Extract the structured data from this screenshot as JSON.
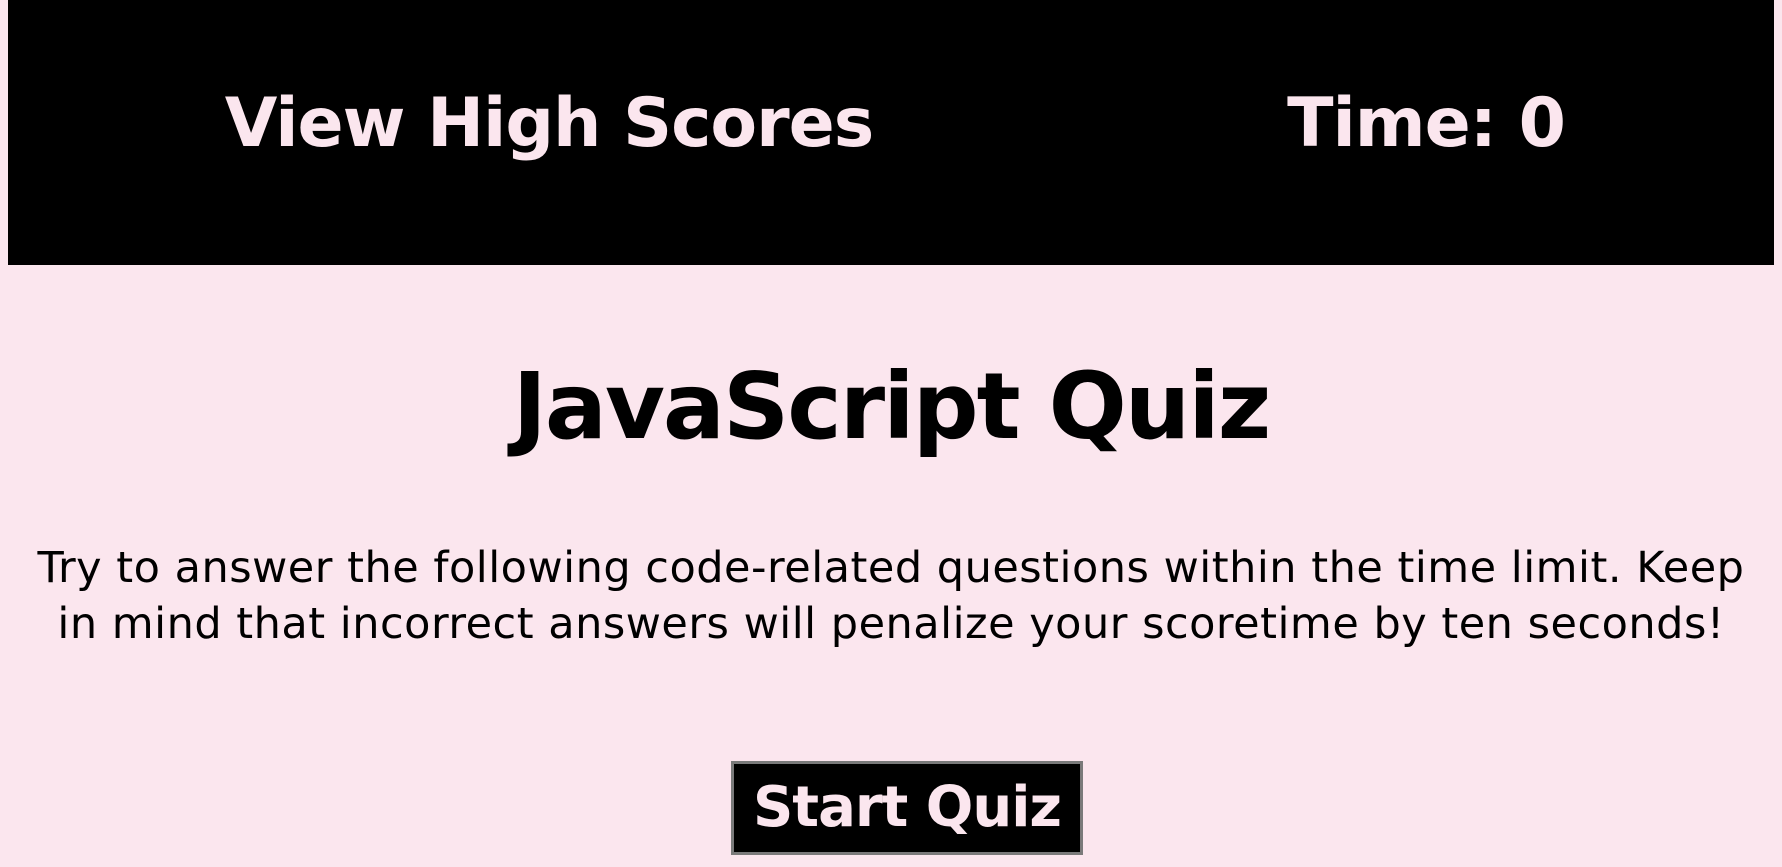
{
  "header": {
    "high_scores_label": "View High Scores",
    "timer_label": "Time: 0"
  },
  "main": {
    "title": "JavaScript Quiz",
    "instructions": "Try to answer the following code-related questions within the time limit. Keep in mind that incorrect answers will penalize your scoretime by ten seconds!",
    "start_button_label": "Start Quiz"
  },
  "colors": {
    "background": "#fbe6ee",
    "header_background": "#000000",
    "header_text": "#fbe6ee",
    "text": "#000000",
    "button_border": "#7a7a7a"
  }
}
